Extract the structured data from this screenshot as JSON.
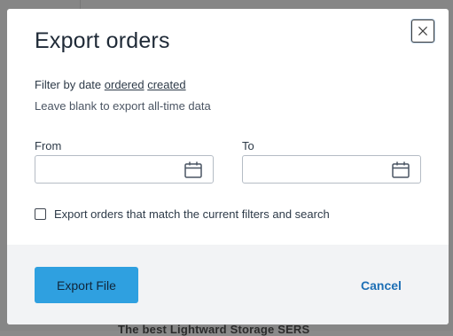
{
  "background": {
    "partial_text": "The best Lightward Storage SERS"
  },
  "modal": {
    "title": "Export orders",
    "filter_prefix": "Filter by date",
    "filter_links": [
      "ordered",
      "created"
    ],
    "hint": "Leave blank to export all-time data",
    "from": {
      "label": "From",
      "value": "",
      "placeholder": ""
    },
    "to": {
      "label": "To",
      "value": "",
      "placeholder": ""
    },
    "checkbox": {
      "label": "Export orders that match the current filters and search",
      "checked": false
    },
    "footer": {
      "export_label": "Export File",
      "cancel_label": "Cancel"
    }
  },
  "icons": {
    "close": "close-icon",
    "calendar": "calendar-icon"
  },
  "colors": {
    "primary_button": "#2fa0e0",
    "link": "#1d6fb5",
    "footer_bg": "#f2f3f5",
    "overlay": "#868686"
  }
}
